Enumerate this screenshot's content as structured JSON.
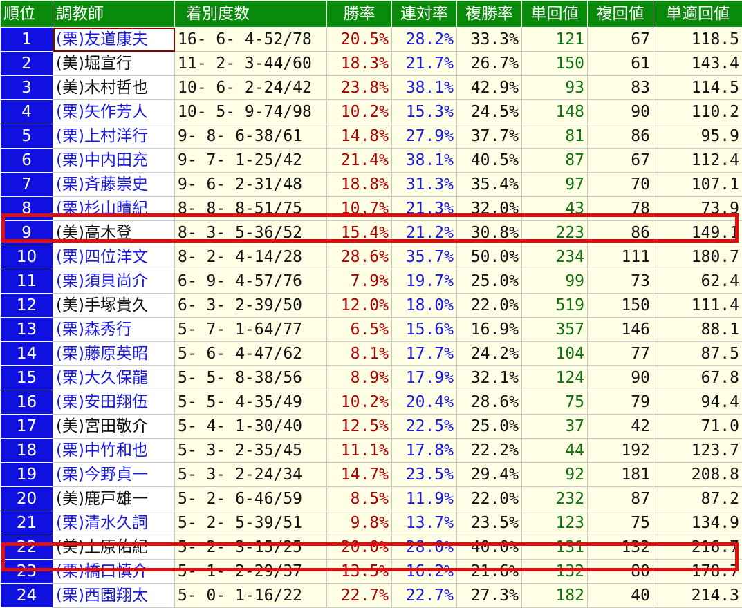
{
  "columns": [
    "順位",
    "調教師",
    "着別度数",
    "勝率",
    "連対率",
    "複勝率",
    "単回値",
    "複回値",
    "単適回値"
  ],
  "colors": {
    "header_bg": "#0a8a0a",
    "rank_bg": "#1010e0",
    "win_rate": "#b00000",
    "rate_blue": "#1a1ae0",
    "return_green": "#107010",
    "row_bg": "#ffffe6",
    "highlight": "#e01010"
  },
  "highlighted_ranks": [
    "9",
    "23"
  ],
  "rows": [
    {
      "rank": "1",
      "trainer": "(栗)友道康夫",
      "trainer_color": "blue",
      "record": "16- 6- 4-52/78",
      "win_rate": "20.5%",
      "quinella_rate": "28.2%",
      "place_rate": "33.3%",
      "win_return": "121",
      "place_return": "67",
      "adj_win_return": "118.5"
    },
    {
      "rank": "2",
      "trainer": "(美)堀宣行",
      "trainer_color": "black",
      "record": "11- 2- 3-44/60",
      "win_rate": "18.3%",
      "quinella_rate": "21.7%",
      "place_rate": "26.7%",
      "win_return": "150",
      "place_return": "61",
      "adj_win_return": "143.4"
    },
    {
      "rank": "3",
      "trainer": "(美)木村哲也",
      "trainer_color": "black",
      "record": "10- 6- 2-24/42",
      "win_rate": "23.8%",
      "quinella_rate": "38.1%",
      "place_rate": "42.9%",
      "win_return": "93",
      "place_return": "83",
      "adj_win_return": "114.5"
    },
    {
      "rank": "4",
      "trainer": "(栗)矢作芳人",
      "trainer_color": "blue",
      "record": "10- 5- 9-74/98",
      "win_rate": "10.2%",
      "quinella_rate": "15.3%",
      "place_rate": "24.5%",
      "win_return": "148",
      "place_return": "90",
      "adj_win_return": "110.2"
    },
    {
      "rank": "5",
      "trainer": "(栗)上村洋行",
      "trainer_color": "blue",
      "record": "9- 8- 6-38/61",
      "win_rate": "14.8%",
      "quinella_rate": "27.9%",
      "place_rate": "37.7%",
      "win_return": "81",
      "place_return": "86",
      "adj_win_return": "95.9"
    },
    {
      "rank": "6",
      "trainer": "(栗)中内田充",
      "trainer_color": "blue",
      "record": "9- 7- 1-25/42",
      "win_rate": "21.4%",
      "quinella_rate": "38.1%",
      "place_rate": "40.5%",
      "win_return": "87",
      "place_return": "67",
      "adj_win_return": "112.4"
    },
    {
      "rank": "7",
      "trainer": "(栗)斉藤崇史",
      "trainer_color": "blue",
      "record": "9- 6- 2-31/48",
      "win_rate": "18.8%",
      "quinella_rate": "31.3%",
      "place_rate": "35.4%",
      "win_return": "97",
      "place_return": "70",
      "adj_win_return": "107.1"
    },
    {
      "rank": "8",
      "trainer": "(栗)杉山晴紀",
      "trainer_color": "blue",
      "record": "8- 8- 8-51/75",
      "win_rate": "10.7%",
      "quinella_rate": "21.3%",
      "place_rate": "32.0%",
      "win_return": "43",
      "place_return": "78",
      "adj_win_return": "73.9"
    },
    {
      "rank": "9",
      "trainer": "(美)高木登",
      "trainer_color": "black",
      "record": "8- 3- 5-36/52",
      "win_rate": "15.4%",
      "quinella_rate": "21.2%",
      "place_rate": "30.8%",
      "win_return": "223",
      "place_return": "86",
      "adj_win_return": "149.1"
    },
    {
      "rank": "10",
      "trainer": "(栗)四位洋文",
      "trainer_color": "blue",
      "record": "8- 2- 4-14/28",
      "win_rate": "28.6%",
      "quinella_rate": "35.7%",
      "place_rate": "50.0%",
      "win_return": "234",
      "place_return": "111",
      "adj_win_return": "180.7"
    },
    {
      "rank": "11",
      "trainer": "(栗)須貝尚介",
      "trainer_color": "blue",
      "record": "6- 9- 4-57/76",
      "win_rate": "7.9%",
      "quinella_rate": "19.7%",
      "place_rate": "25.0%",
      "win_return": "99",
      "place_return": "73",
      "adj_win_return": "62.4"
    },
    {
      "rank": "12",
      "trainer": "(美)手塚貴久",
      "trainer_color": "black",
      "record": "6- 3- 2-39/50",
      "win_rate": "12.0%",
      "quinella_rate": "18.0%",
      "place_rate": "22.0%",
      "win_return": "519",
      "place_return": "150",
      "adj_win_return": "111.4"
    },
    {
      "rank": "13",
      "trainer": "(栗)森秀行",
      "trainer_color": "blue",
      "record": "5- 7- 1-64/77",
      "win_rate": "6.5%",
      "quinella_rate": "15.6%",
      "place_rate": "16.9%",
      "win_return": "357",
      "place_return": "146",
      "adj_win_return": "88.1"
    },
    {
      "rank": "14",
      "trainer": "(栗)藤原英昭",
      "trainer_color": "blue",
      "record": "5- 6- 4-47/62",
      "win_rate": "8.1%",
      "quinella_rate": "17.7%",
      "place_rate": "24.2%",
      "win_return": "104",
      "place_return": "77",
      "adj_win_return": "87.5"
    },
    {
      "rank": "15",
      "trainer": "(栗)大久保龍",
      "trainer_color": "blue",
      "record": "5- 5- 8-38/56",
      "win_rate": "8.9%",
      "quinella_rate": "17.9%",
      "place_rate": "32.1%",
      "win_return": "124",
      "place_return": "90",
      "adj_win_return": "67.8"
    },
    {
      "rank": "16",
      "trainer": "(栗)安田翔伍",
      "trainer_color": "blue",
      "record": "5- 5- 4-35/49",
      "win_rate": "10.2%",
      "quinella_rate": "20.4%",
      "place_rate": "28.6%",
      "win_return": "75",
      "place_return": "79",
      "adj_win_return": "94.4"
    },
    {
      "rank": "17",
      "trainer": "(美)宮田敬介",
      "trainer_color": "black",
      "record": "5- 4- 1-30/40",
      "win_rate": "12.5%",
      "quinella_rate": "22.5%",
      "place_rate": "25.0%",
      "win_return": "37",
      "place_return": "42",
      "adj_win_return": "71.0"
    },
    {
      "rank": "18",
      "trainer": "(栗)中竹和也",
      "trainer_color": "blue",
      "record": "5- 3- 2-35/45",
      "win_rate": "11.1%",
      "quinella_rate": "17.8%",
      "place_rate": "22.2%",
      "win_return": "44",
      "place_return": "192",
      "adj_win_return": "123.7"
    },
    {
      "rank": "19",
      "trainer": "(栗)今野貞一",
      "trainer_color": "blue",
      "record": "5- 3- 2-24/34",
      "win_rate": "14.7%",
      "quinella_rate": "23.5%",
      "place_rate": "29.4%",
      "win_return": "92",
      "place_return": "181",
      "adj_win_return": "208.8"
    },
    {
      "rank": "20",
      "trainer": "(美)鹿戸雄一",
      "trainer_color": "black",
      "record": "5- 2- 6-46/59",
      "win_rate": "8.5%",
      "quinella_rate": "11.9%",
      "place_rate": "22.0%",
      "win_return": "232",
      "place_return": "87",
      "adj_win_return": "87.2"
    },
    {
      "rank": "21",
      "trainer": "(栗)清水久詞",
      "trainer_color": "blue",
      "record": "5- 2- 5-39/51",
      "win_rate": "9.8%",
      "quinella_rate": "13.7%",
      "place_rate": "23.5%",
      "win_return": "123",
      "place_return": "75",
      "adj_win_return": "134.9"
    },
    {
      "rank": "22",
      "trainer": "(美)上原佑紀",
      "trainer_color": "black",
      "record": "5- 2- 3-15/25",
      "win_rate": "20.0%",
      "quinella_rate": "28.0%",
      "place_rate": "40.0%",
      "win_return": "131",
      "place_return": "132",
      "adj_win_return": "216.7"
    },
    {
      "rank": "23",
      "trainer": "(栗)橋口慎介",
      "trainer_color": "blue",
      "record": "5- 1- 2-29/37",
      "win_rate": "13.5%",
      "quinella_rate": "16.2%",
      "place_rate": "21.6%",
      "win_return": "132",
      "place_return": "80",
      "adj_win_return": "178.7"
    },
    {
      "rank": "24",
      "trainer": "(栗)西園翔太",
      "trainer_color": "blue",
      "record": "5- 0- 1-16/22",
      "win_rate": "22.7%",
      "quinella_rate": "22.7%",
      "place_rate": "27.3%",
      "win_return": "182",
      "place_return": "40",
      "adj_win_return": "214.3"
    }
  ]
}
